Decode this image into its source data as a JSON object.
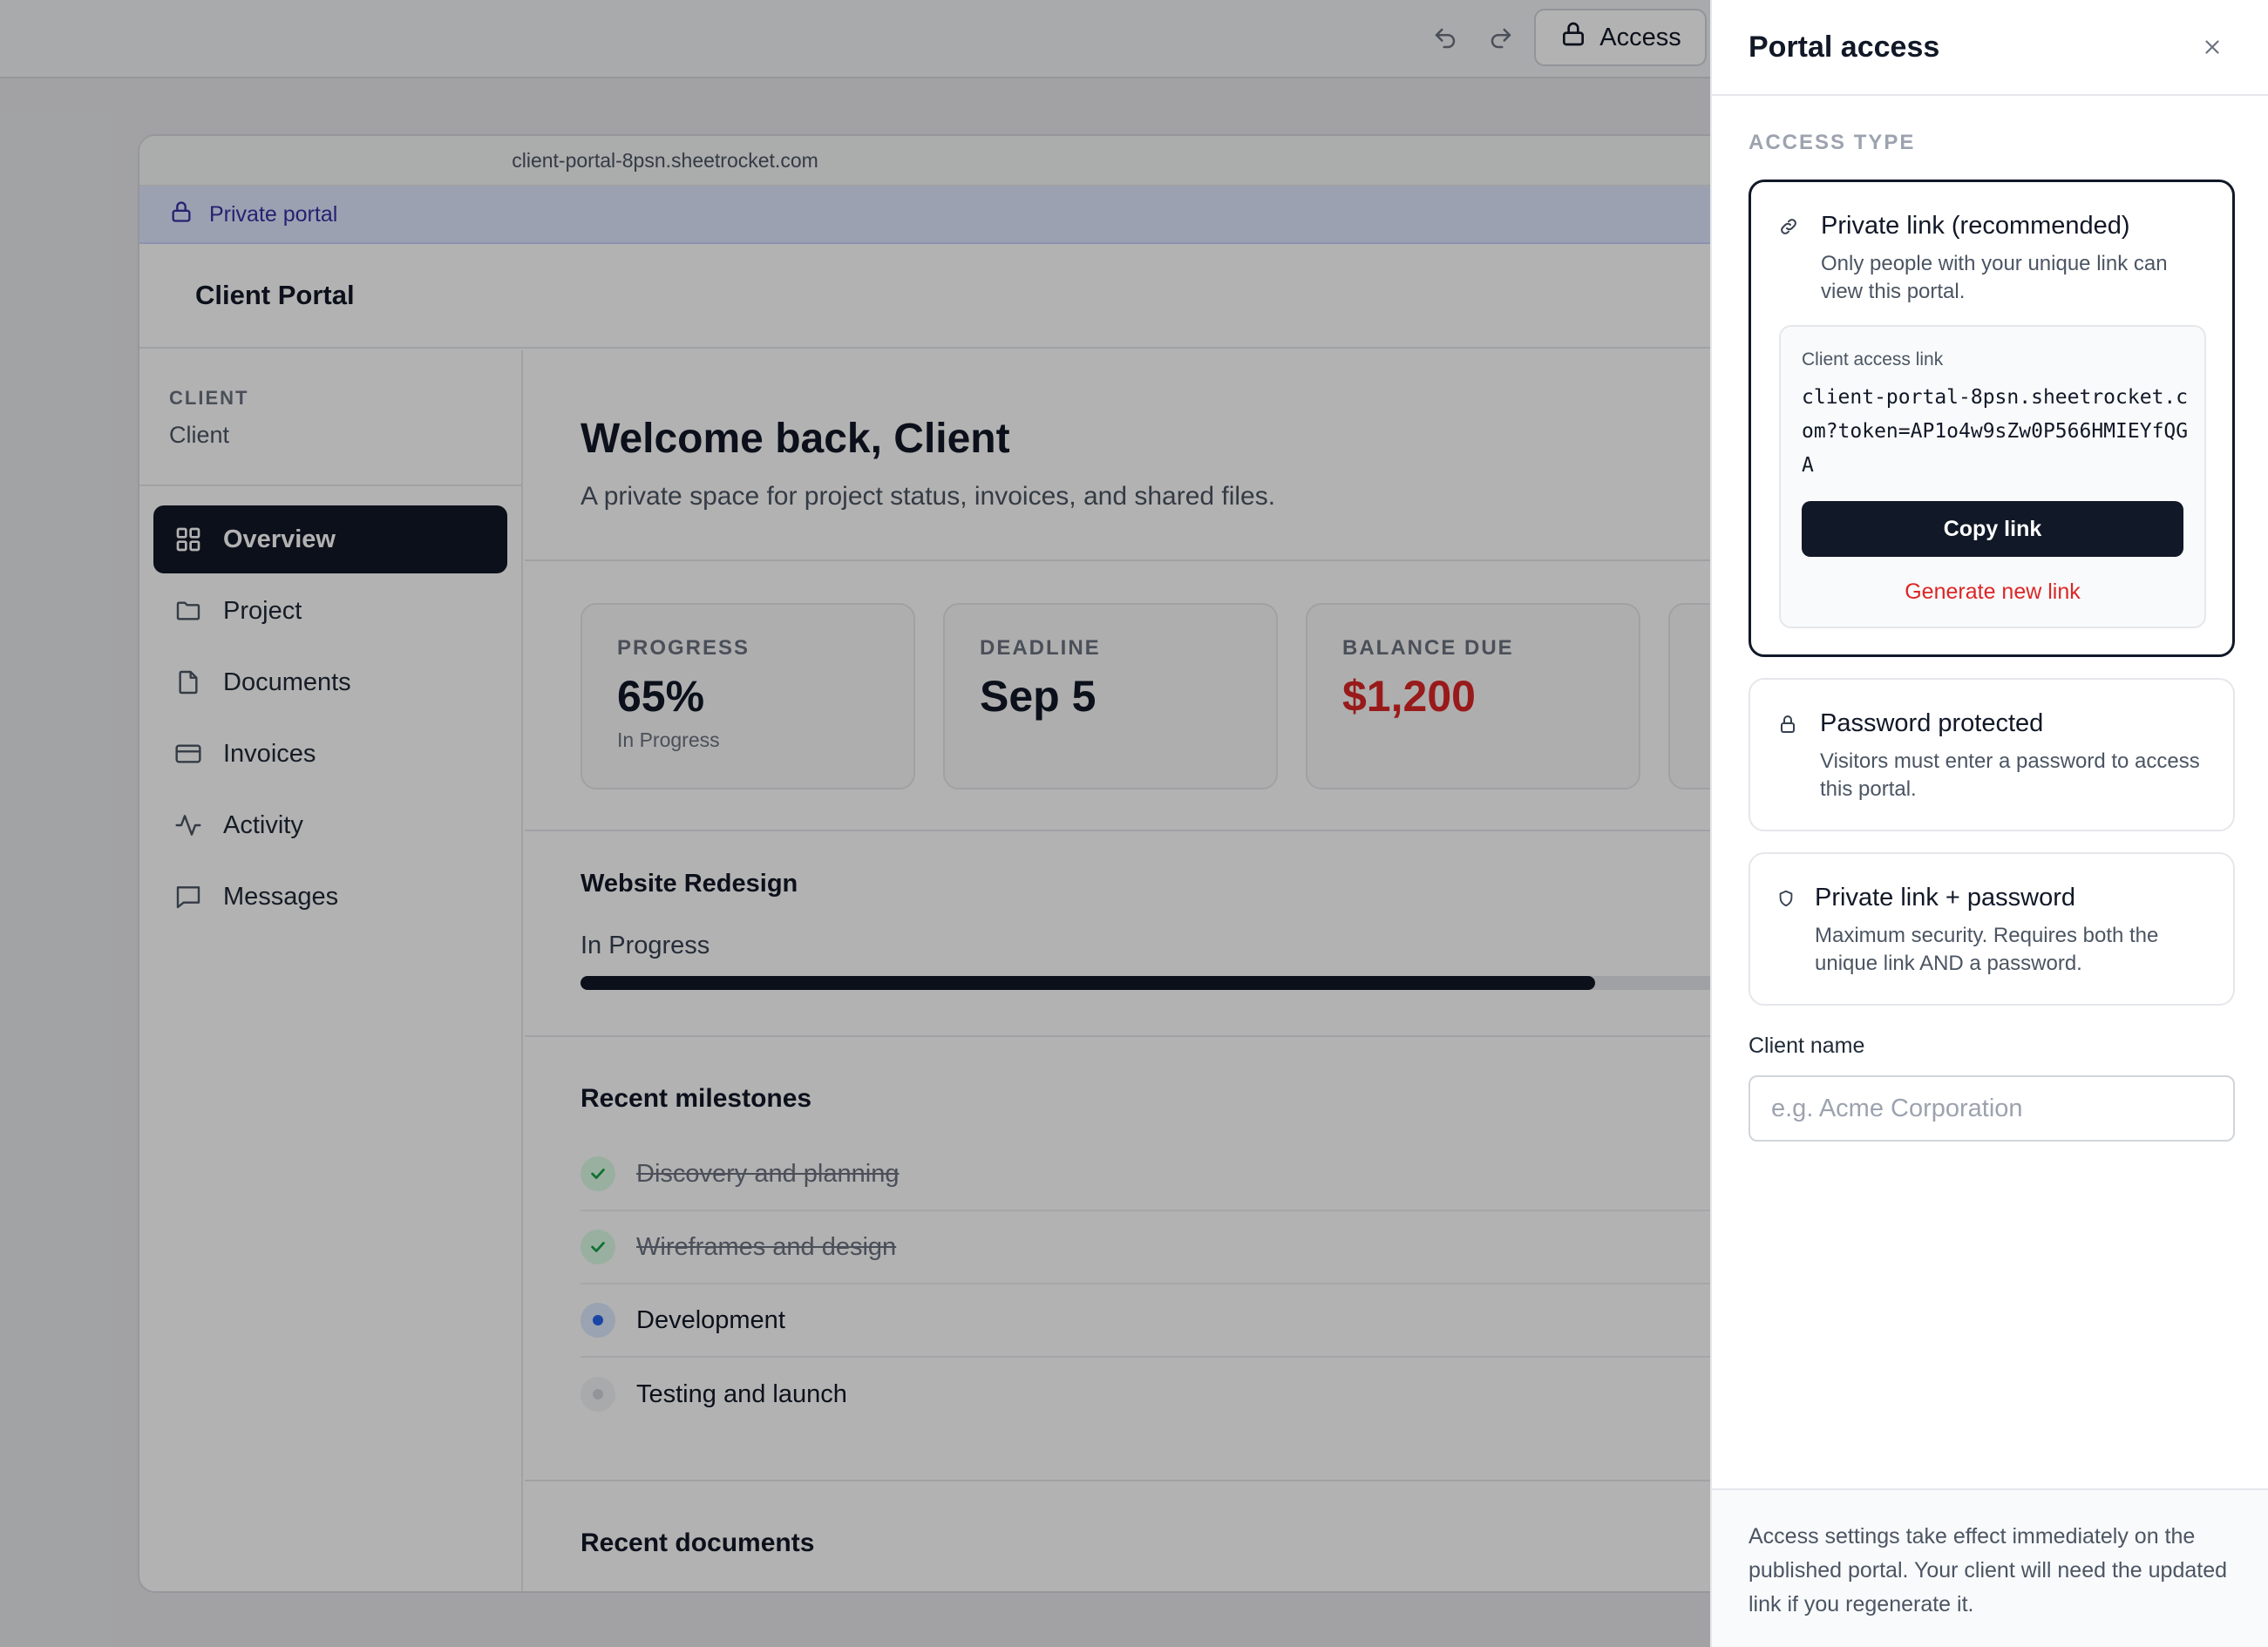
{
  "toolbar": {
    "undo_icon": "undo-icon",
    "redo_icon": "redo-icon",
    "access_icon": "lock-icon",
    "access_label": "Access"
  },
  "portal": {
    "url": "client-portal-8psn.sheetrocket.com",
    "banner": {
      "icon": "lock-icon",
      "text": "Private portal"
    },
    "header_title": "Client Portal",
    "client": {
      "label": "CLIENT",
      "name": "Client"
    },
    "nav": [
      {
        "label": "Overview",
        "icon": "grid-icon",
        "active": true
      },
      {
        "label": "Project",
        "icon": "folder-icon",
        "active": false
      },
      {
        "label": "Documents",
        "icon": "document-icon",
        "active": false
      },
      {
        "label": "Invoices",
        "icon": "credit-card-icon",
        "active": false
      },
      {
        "label": "Activity",
        "icon": "activity-icon",
        "active": false
      },
      {
        "label": "Messages",
        "icon": "message-icon",
        "active": false
      }
    ],
    "welcome": {
      "title": "Welcome back, Client",
      "subtitle": "A private space for project status, invoices, and shared files."
    },
    "stats": [
      {
        "label": "PROGRESS",
        "value": "65%",
        "sub": "In Progress"
      },
      {
        "label": "DEADLINE",
        "value": "Sep 5",
        "sub": ""
      },
      {
        "label": "BALANCE DUE",
        "value": "$1,200",
        "sub": ""
      }
    ],
    "project": {
      "title": "Website Redesign",
      "status": "In Progress",
      "progress": 0.65
    },
    "milestones": {
      "title": "Recent milestones",
      "items": [
        {
          "label": "Discovery and planning",
          "state": "done"
        },
        {
          "label": "Wireframes and design",
          "state": "done"
        },
        {
          "label": "Development",
          "state": "current"
        },
        {
          "label": "Testing and launch",
          "state": "pending"
        }
      ]
    },
    "documents_title": "Recent documents"
  },
  "drawer": {
    "title": "Portal access",
    "close_icon": "close-icon",
    "section_label": "ACCESS TYPE",
    "options": [
      {
        "title": "Private link (recommended)",
        "desc": "Only people with your unique link can view this portal.",
        "icon": "link-icon",
        "selected": true
      },
      {
        "title": "Password protected",
        "desc": "Visitors must enter a password to access this portal.",
        "icon": "lock-icon",
        "selected": false
      },
      {
        "title": "Private link + password",
        "desc": "Maximum security. Requires both the unique link AND a password.",
        "icon": "shield-icon",
        "selected": false
      }
    ],
    "link_box": {
      "label": "Client access link",
      "url": "client-portal-8psn.sheetrocket.com?token=AP1o4w9sZw0P566HMIEYfQGA",
      "copy_label": "Copy link",
      "regenerate_label": "Generate new link"
    },
    "client_name": {
      "label": "Client name",
      "placeholder": "e.g. Acme Corporation",
      "value": ""
    },
    "footer": "Access settings take effect immediately on the published portal. Your client will need the updated link if you regenerate it."
  },
  "colors": {
    "primary": "#111827",
    "danger": "#dc2626",
    "success": "#16a34a",
    "accent": "#4f46e5",
    "banner_bg": "#e0e7ff"
  }
}
